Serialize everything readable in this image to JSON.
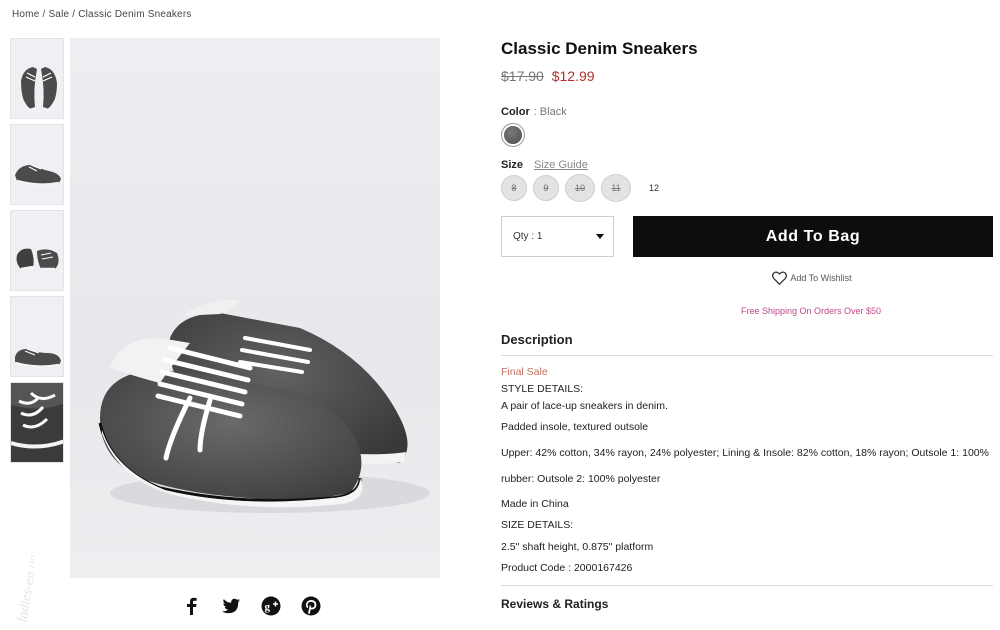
{
  "breadcrumb": {
    "home": "Home",
    "sale": "Sale",
    "current": "Classic Denim Sneakers",
    "separator": "/"
  },
  "product": {
    "title": "Classic Denim Sneakers",
    "old_price": "$17.90",
    "new_price": "$12.99",
    "color_label": "Color",
    "color_sep": ":",
    "color_value": "Black",
    "size_label": "Size",
    "size_guide": "Size Guide",
    "sizes": [
      {
        "label": "8",
        "available": false
      },
      {
        "label": "9",
        "available": false
      },
      {
        "label": "10",
        "available": false
      },
      {
        "label": "11",
        "available": false
      },
      {
        "label": "12",
        "available": true
      }
    ],
    "qty_label": "Qty : 1",
    "add_to_bag": "Add To Bag",
    "wishlist": "Add To Wishlist",
    "free_shipping": "Free Shipping On Orders Over $50"
  },
  "description": {
    "heading": "Description",
    "final_sale": "Final Sale",
    "style_details": "STYLE DETAILS:",
    "line1": "A pair of lace-up sneakers in denim.",
    "line2": "Padded insole, textured outsole",
    "line3": "Upper: 42% cotton, 34% rayon, 24% polyester; Lining & Insole: 82% cotton, 18% rayon; Outsole 1: 100%",
    "line4": "rubber: Outsole 2: 100% polyester",
    "line5": "Made in China",
    "size_details": "SIZE DETAILS:",
    "line6": "2.5\" shaft height, 0.875\" platform",
    "product_code": "Product Code : 2000167426"
  },
  "reviews": {
    "heading": "Reviews & Ratings"
  },
  "share_icons": [
    "facebook-icon",
    "twitter-icon",
    "google-plus-icon",
    "pinterest-icon"
  ],
  "colors": {
    "sale_red": "#b0302b",
    "shipping_pink": "#c04a86",
    "button_black": "#0d0d0d",
    "final_sale": "#c07060"
  }
}
